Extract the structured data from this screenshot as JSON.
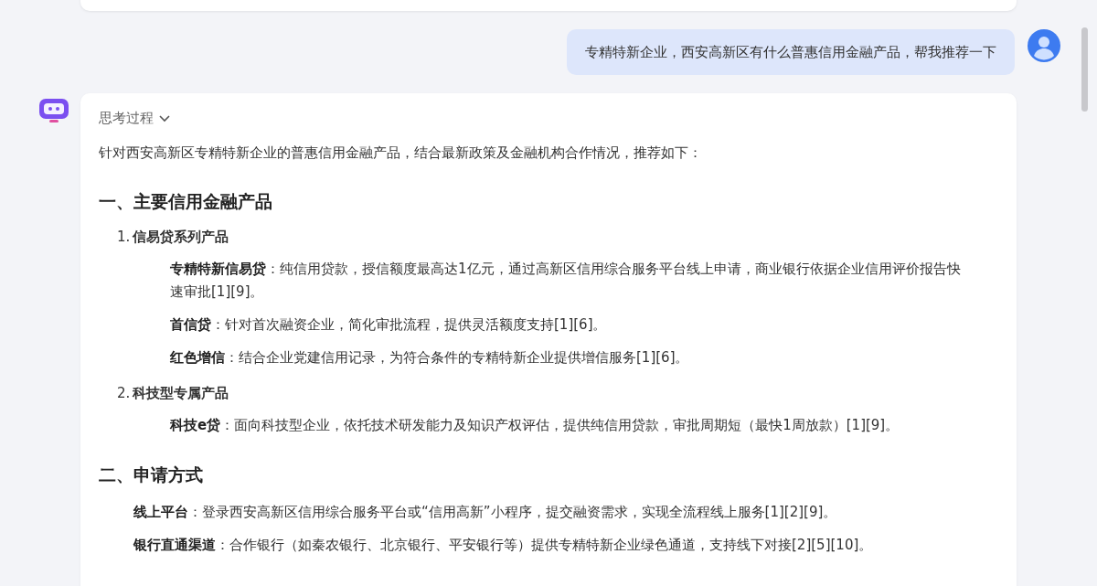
{
  "user_message": "专精特新企业，西安高新区有什么普惠信用金融产品，帮我推荐一下",
  "answer": {
    "thinking_label": "思考过程",
    "thinking_expanded": false,
    "intro": "针对西安高新区专精特新企业的普惠信用金融产品，结合最新政策及金融机构合作情况，推荐如下：",
    "sections": [
      {
        "heading": "一、主要信用金融产品",
        "items": [
          {
            "kind": "numbered",
            "number": "1.",
            "title": "信易贷系列产品",
            "entries": [
              "**专精特新信易贷**：纯信用贷款，授信额度最高达1亿元，通过高新区信用综合服务平台线上申请，商业银行依据企业信用评价报告快速审批[1][9]。",
              "**首信贷**：针对首次融资企业，简化审批流程，提供灵活额度支持[1][6]。",
              "**红色增信**：结合企业党建信用记录，为符合条件的专精特新企业提供增信服务[1][6]。"
            ]
          },
          {
            "kind": "numbered",
            "number": "2.",
            "title": "科技型专属产品",
            "entries": [
              "**科技e贷**：面向科技型企业，依托技术研发能力及知识产权评估，提供纯信用贷款，审批周期短（最快1周放款）[1][9]。"
            ]
          }
        ]
      },
      {
        "heading": "二、申请方式",
        "items": [
          {
            "kind": "entry",
            "text": "**线上平台**：登录西安高新区信用综合服务平台或“信用高新”小程序，提交融资需求，实现全流程线上服务[1][2][9]。"
          },
          {
            "kind": "entry",
            "text": "**银行直通渠道**：合作银行（如秦农银行、北京银行、平安银行等）提供专精特新企业绿色通道，支持线下对接[2][5][10]。"
          }
        ]
      }
    ]
  }
}
